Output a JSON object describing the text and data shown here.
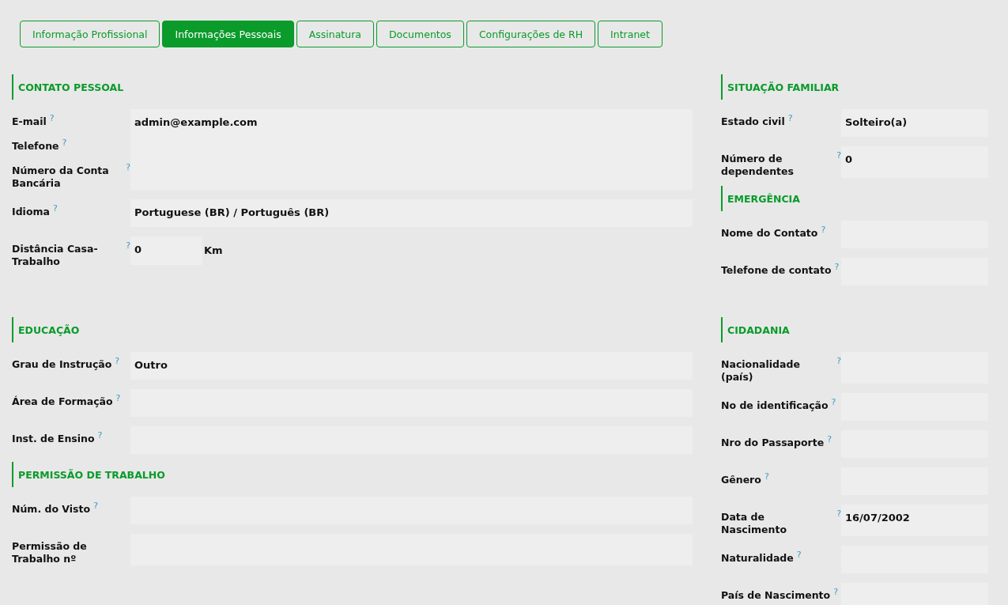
{
  "tabs": [
    {
      "label": "Informação Profissional",
      "selected": false
    },
    {
      "label": "Informações Pessoais",
      "selected": true
    },
    {
      "label": "Assinatura",
      "selected": false
    },
    {
      "label": "Documentos",
      "selected": false
    },
    {
      "label": "Configurações de RH",
      "selected": false
    },
    {
      "label": "Intranet",
      "selected": false
    }
  ],
  "columns": [
    {
      "sections": [
        {
          "title": "CONTATO PESSOAL",
          "fields": [
            {
              "kind": "stacked",
              "labels": [
                {
                  "label": "E-mail",
                  "help": "?"
                },
                {
                  "label": "Telefone",
                  "help": "?"
                },
                {
                  "label": "Número da Conta Bancária",
                  "help": "?"
                }
              ],
              "value": "admin@example.com"
            },
            {
              "kind": "field",
              "label": "Idioma",
              "help": "?",
              "value": "Portuguese (BR) / Português (BR)"
            },
            {
              "kind": "unit",
              "label": "Distância Casa-Trabalho",
              "help": "?",
              "value": "0",
              "unit": "Km"
            }
          ]
        }
      ],
      "sections2": [
        {
          "title": "EDUCAÇÃO",
          "fields": [
            {
              "kind": "field",
              "label": "Grau de Instrução",
              "help": "?",
              "value": "Outro"
            },
            {
              "kind": "field",
              "label": "Área de Formação",
              "help": "?"
            },
            {
              "kind": "field",
              "label": "Inst. de Ensino",
              "help": "?"
            }
          ]
        },
        {
          "title": "PERMISSÃO DE TRABALHO",
          "fields": [
            {
              "kind": "field",
              "label": "Núm. do Visto",
              "help": "?"
            },
            {
              "kind": "field",
              "label": "Permissão de Trabalho nº"
            }
          ]
        }
      ]
    },
    {
      "sections": [
        {
          "title": "SITUAÇÃO FAMILIAR",
          "fields": [
            {
              "kind": "field",
              "label": "Estado civil",
              "help": "?",
              "value": "Solteiro(a)"
            },
            {
              "kind": "field",
              "label": "Número de dependentes",
              "help": "?",
              "value": "0"
            }
          ]
        },
        {
          "title": "EMERGÊNCIA",
          "fields": [
            {
              "kind": "field",
              "label": "Nome do Contato",
              "help": "?"
            },
            {
              "kind": "field",
              "label": "Telefone de contato",
              "help": "?"
            }
          ]
        }
      ],
      "sections2": [
        {
          "title": "CIDADANIA",
          "fields": [
            {
              "kind": "field",
              "label": "Nacionalidade (país)",
              "help": "?"
            },
            {
              "kind": "field",
              "label": "No de identificação",
              "help": "?"
            },
            {
              "kind": "field",
              "label": "Nro do Passaporte",
              "help": "?"
            },
            {
              "kind": "field",
              "label": "Gênero",
              "help": "?"
            },
            {
              "kind": "field",
              "label": "Data de Nascimento",
              "help": "?",
              "value": "16/07/2002"
            },
            {
              "kind": "field",
              "label": "Naturalidade",
              "help": "?"
            },
            {
              "kind": "field",
              "label": "País de Nascimento",
              "help": "?"
            }
          ]
        }
      ]
    }
  ]
}
